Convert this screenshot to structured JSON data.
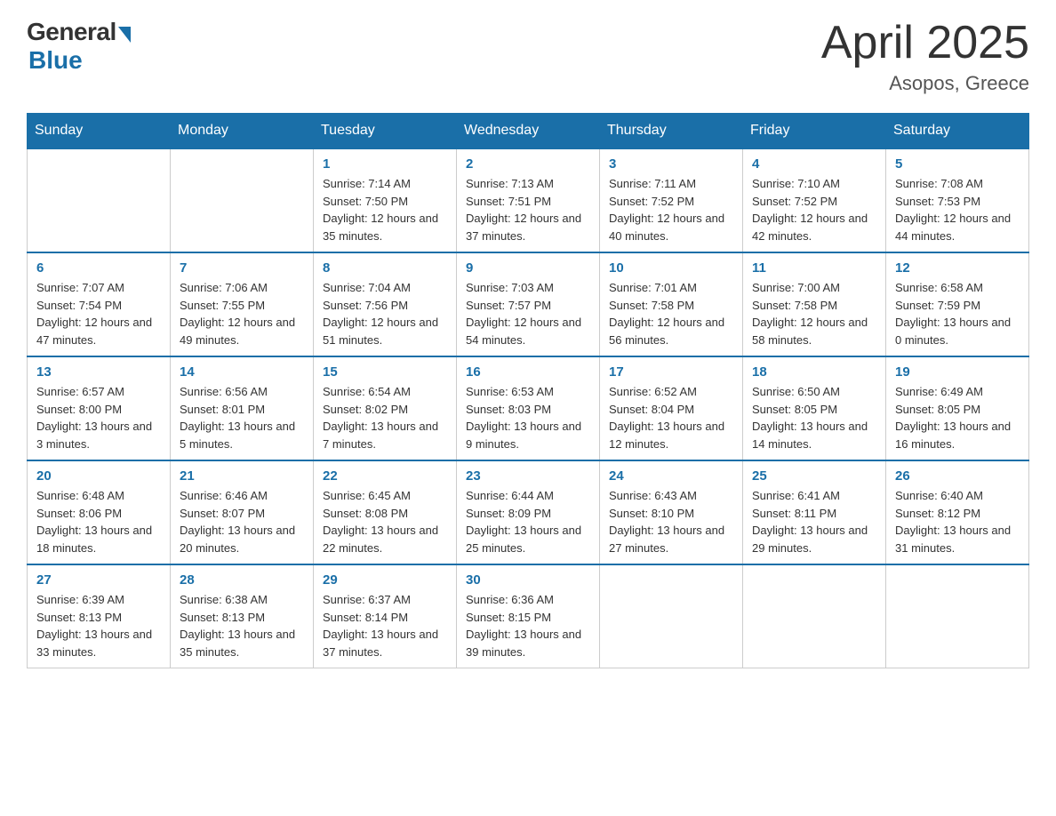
{
  "header": {
    "logo_general": "General",
    "logo_blue": "Blue",
    "title": "April 2025",
    "subtitle": "Asopos, Greece"
  },
  "days_of_week": [
    "Sunday",
    "Monday",
    "Tuesday",
    "Wednesday",
    "Thursday",
    "Friday",
    "Saturday"
  ],
  "weeks": [
    [
      {
        "day": "",
        "sunrise": "",
        "sunset": "",
        "daylight": ""
      },
      {
        "day": "",
        "sunrise": "",
        "sunset": "",
        "daylight": ""
      },
      {
        "day": "1",
        "sunrise": "Sunrise: 7:14 AM",
        "sunset": "Sunset: 7:50 PM",
        "daylight": "Daylight: 12 hours and 35 minutes."
      },
      {
        "day": "2",
        "sunrise": "Sunrise: 7:13 AM",
        "sunset": "Sunset: 7:51 PM",
        "daylight": "Daylight: 12 hours and 37 minutes."
      },
      {
        "day": "3",
        "sunrise": "Sunrise: 7:11 AM",
        "sunset": "Sunset: 7:52 PM",
        "daylight": "Daylight: 12 hours and 40 minutes."
      },
      {
        "day": "4",
        "sunrise": "Sunrise: 7:10 AM",
        "sunset": "Sunset: 7:52 PM",
        "daylight": "Daylight: 12 hours and 42 minutes."
      },
      {
        "day": "5",
        "sunrise": "Sunrise: 7:08 AM",
        "sunset": "Sunset: 7:53 PM",
        "daylight": "Daylight: 12 hours and 44 minutes."
      }
    ],
    [
      {
        "day": "6",
        "sunrise": "Sunrise: 7:07 AM",
        "sunset": "Sunset: 7:54 PM",
        "daylight": "Daylight: 12 hours and 47 minutes."
      },
      {
        "day": "7",
        "sunrise": "Sunrise: 7:06 AM",
        "sunset": "Sunset: 7:55 PM",
        "daylight": "Daylight: 12 hours and 49 minutes."
      },
      {
        "day": "8",
        "sunrise": "Sunrise: 7:04 AM",
        "sunset": "Sunset: 7:56 PM",
        "daylight": "Daylight: 12 hours and 51 minutes."
      },
      {
        "day": "9",
        "sunrise": "Sunrise: 7:03 AM",
        "sunset": "Sunset: 7:57 PM",
        "daylight": "Daylight: 12 hours and 54 minutes."
      },
      {
        "day": "10",
        "sunrise": "Sunrise: 7:01 AM",
        "sunset": "Sunset: 7:58 PM",
        "daylight": "Daylight: 12 hours and 56 minutes."
      },
      {
        "day": "11",
        "sunrise": "Sunrise: 7:00 AM",
        "sunset": "Sunset: 7:58 PM",
        "daylight": "Daylight: 12 hours and 58 minutes."
      },
      {
        "day": "12",
        "sunrise": "Sunrise: 6:58 AM",
        "sunset": "Sunset: 7:59 PM",
        "daylight": "Daylight: 13 hours and 0 minutes."
      }
    ],
    [
      {
        "day": "13",
        "sunrise": "Sunrise: 6:57 AM",
        "sunset": "Sunset: 8:00 PM",
        "daylight": "Daylight: 13 hours and 3 minutes."
      },
      {
        "day": "14",
        "sunrise": "Sunrise: 6:56 AM",
        "sunset": "Sunset: 8:01 PM",
        "daylight": "Daylight: 13 hours and 5 minutes."
      },
      {
        "day": "15",
        "sunrise": "Sunrise: 6:54 AM",
        "sunset": "Sunset: 8:02 PM",
        "daylight": "Daylight: 13 hours and 7 minutes."
      },
      {
        "day": "16",
        "sunrise": "Sunrise: 6:53 AM",
        "sunset": "Sunset: 8:03 PM",
        "daylight": "Daylight: 13 hours and 9 minutes."
      },
      {
        "day": "17",
        "sunrise": "Sunrise: 6:52 AM",
        "sunset": "Sunset: 8:04 PM",
        "daylight": "Daylight: 13 hours and 12 minutes."
      },
      {
        "day": "18",
        "sunrise": "Sunrise: 6:50 AM",
        "sunset": "Sunset: 8:05 PM",
        "daylight": "Daylight: 13 hours and 14 minutes."
      },
      {
        "day": "19",
        "sunrise": "Sunrise: 6:49 AM",
        "sunset": "Sunset: 8:05 PM",
        "daylight": "Daylight: 13 hours and 16 minutes."
      }
    ],
    [
      {
        "day": "20",
        "sunrise": "Sunrise: 6:48 AM",
        "sunset": "Sunset: 8:06 PM",
        "daylight": "Daylight: 13 hours and 18 minutes."
      },
      {
        "day": "21",
        "sunrise": "Sunrise: 6:46 AM",
        "sunset": "Sunset: 8:07 PM",
        "daylight": "Daylight: 13 hours and 20 minutes."
      },
      {
        "day": "22",
        "sunrise": "Sunrise: 6:45 AM",
        "sunset": "Sunset: 8:08 PM",
        "daylight": "Daylight: 13 hours and 22 minutes."
      },
      {
        "day": "23",
        "sunrise": "Sunrise: 6:44 AM",
        "sunset": "Sunset: 8:09 PM",
        "daylight": "Daylight: 13 hours and 25 minutes."
      },
      {
        "day": "24",
        "sunrise": "Sunrise: 6:43 AM",
        "sunset": "Sunset: 8:10 PM",
        "daylight": "Daylight: 13 hours and 27 minutes."
      },
      {
        "day": "25",
        "sunrise": "Sunrise: 6:41 AM",
        "sunset": "Sunset: 8:11 PM",
        "daylight": "Daylight: 13 hours and 29 minutes."
      },
      {
        "day": "26",
        "sunrise": "Sunrise: 6:40 AM",
        "sunset": "Sunset: 8:12 PM",
        "daylight": "Daylight: 13 hours and 31 minutes."
      }
    ],
    [
      {
        "day": "27",
        "sunrise": "Sunrise: 6:39 AM",
        "sunset": "Sunset: 8:13 PM",
        "daylight": "Daylight: 13 hours and 33 minutes."
      },
      {
        "day": "28",
        "sunrise": "Sunrise: 6:38 AM",
        "sunset": "Sunset: 8:13 PM",
        "daylight": "Daylight: 13 hours and 35 minutes."
      },
      {
        "day": "29",
        "sunrise": "Sunrise: 6:37 AM",
        "sunset": "Sunset: 8:14 PM",
        "daylight": "Daylight: 13 hours and 37 minutes."
      },
      {
        "day": "30",
        "sunrise": "Sunrise: 6:36 AM",
        "sunset": "Sunset: 8:15 PM",
        "daylight": "Daylight: 13 hours and 39 minutes."
      },
      {
        "day": "",
        "sunrise": "",
        "sunset": "",
        "daylight": ""
      },
      {
        "day": "",
        "sunrise": "",
        "sunset": "",
        "daylight": ""
      },
      {
        "day": "",
        "sunrise": "",
        "sunset": "",
        "daylight": ""
      }
    ]
  ]
}
